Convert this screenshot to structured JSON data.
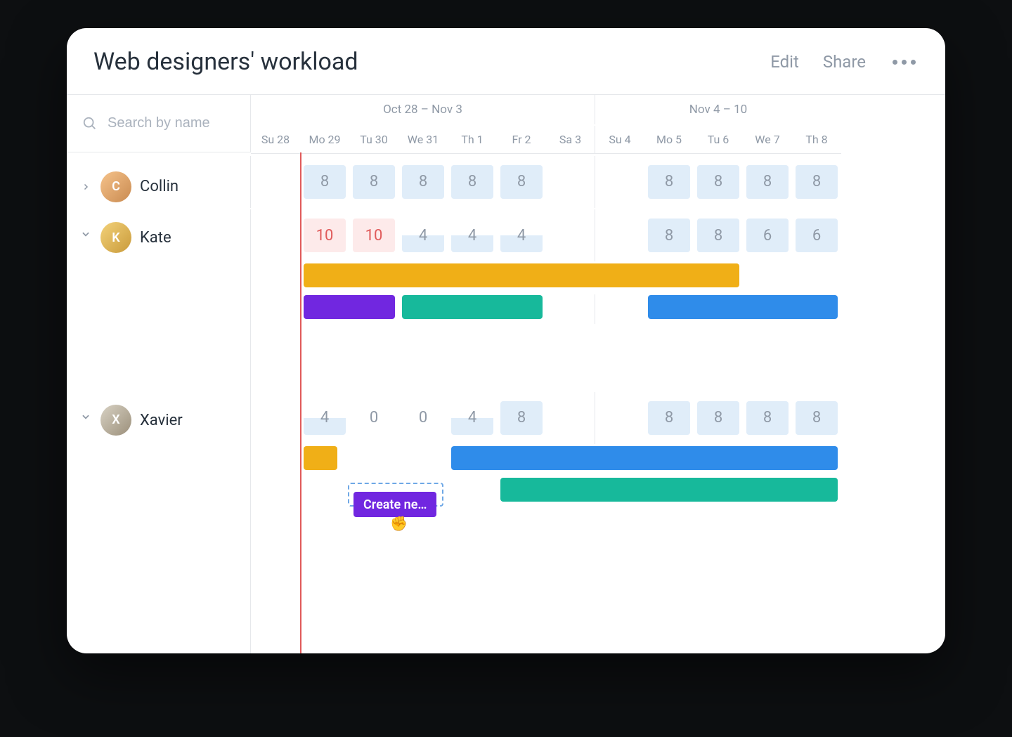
{
  "title": "Web designers' workload",
  "actions": {
    "edit": "Edit",
    "share": "Share"
  },
  "search": {
    "placeholder": "Search by name"
  },
  "weeks": {
    "w1": "Oct 28 –  Nov 3",
    "w2": "Nov 4 – 10"
  },
  "days": [
    "Su 28",
    "Mo 29",
    "Tu 30",
    "We 31",
    "Th 1",
    "Fr 2",
    "Sa 3",
    "Su 4",
    "Mo 5",
    "Tu 6",
    "We 7",
    "Th 8"
  ],
  "people": {
    "collin": {
      "name": "Collin",
      "expanded": false,
      "hours": [
        "",
        "8",
        "8",
        "8",
        "8",
        "8",
        "",
        "",
        "8",
        "8",
        "8",
        "8"
      ],
      "style": [
        "",
        "lightblue",
        "lightblue",
        "lightblue",
        "lightblue",
        "lightblue",
        "",
        "",
        "lightblue",
        "lightblue",
        "lightblue",
        "lightblue"
      ]
    },
    "kate": {
      "name": "Kate",
      "expanded": true,
      "hours": [
        "",
        "10",
        "10",
        "4",
        "4",
        "4",
        "",
        "",
        "8",
        "8",
        "6",
        "6"
      ],
      "style": [
        "",
        "red",
        "red",
        "half-blue",
        "half-blue",
        "half-blue",
        "",
        "",
        "lightblue",
        "lightblue",
        "lightblue",
        "lightblue"
      ],
      "tasks": [
        {
          "color": "c-yellow",
          "startCol": 2,
          "span": 9
        },
        {
          "color": "c-purple",
          "startCol": 2,
          "span": 2
        },
        {
          "color": "c-teal",
          "startCol": 4,
          "span": 3
        },
        {
          "color": "c-blue",
          "startCol": 9,
          "span": 4
        }
      ]
    },
    "xavier": {
      "name": "Xavier",
      "expanded": true,
      "hours": [
        "",
        "4",
        "0",
        "0",
        "4",
        "8",
        "",
        "",
        "8",
        "8",
        "8",
        "8"
      ],
      "style": [
        "",
        "half-blue",
        "none",
        "none",
        "half-blue",
        "lightblue",
        "",
        "",
        "lightblue",
        "lightblue",
        "lightblue",
        "lightblue"
      ],
      "tasks": [
        {
          "color": "c-yellow",
          "startCol": 2,
          "span": 1,
          "short": true
        },
        {
          "color": "c-blue",
          "startCol": 5,
          "span": 8
        },
        {
          "color": "c-teal",
          "startCol": 6,
          "span": 7
        }
      ],
      "createLabel": "Create ne…"
    }
  },
  "colors": {
    "yellow": "#f0af17",
    "purple": "#7127e0",
    "teal": "#17b99b",
    "blue": "#2f8cea",
    "red": "#e05a5a"
  }
}
